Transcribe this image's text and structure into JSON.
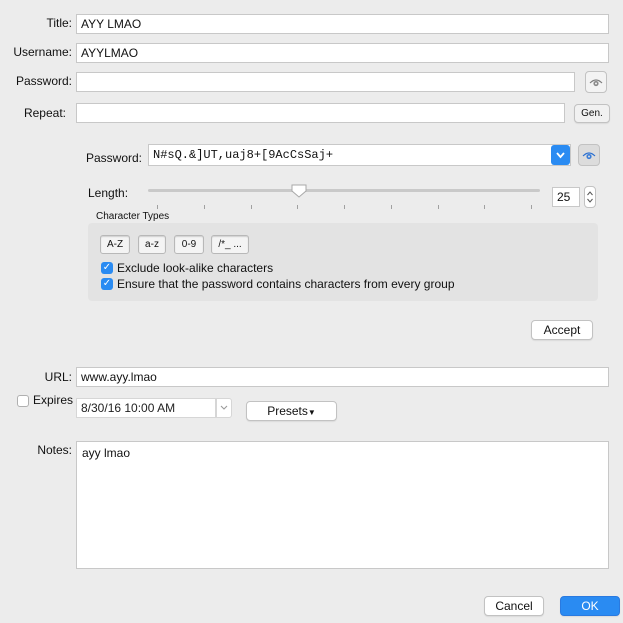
{
  "form": {
    "title_label": "Title:",
    "title_value": "AYY LMAO",
    "username_label": "Username:",
    "username_value": "AYYLMAO",
    "password_label": "Password:",
    "password_value": "",
    "repeat_label": "Repeat:",
    "repeat_value": "",
    "gen_button": "Gen.",
    "url_label": "URL:",
    "url_value": "www.ayy.lmao",
    "expires_label": "Expires",
    "expires_checked": false,
    "expires_value": "8/30/16 10:00 AM",
    "presets_button": "Presets",
    "notes_label": "Notes:",
    "notes_value": "ayy lmao"
  },
  "generator": {
    "password_label": "Password:",
    "password_value": "N#sQ.&]UT,uaj8+[9AcCsSaj+",
    "length_label": "Length:",
    "length_value": "25",
    "length_min": 1,
    "length_max": 64,
    "char_types_label": "Character Types",
    "char_types": [
      "A-Z",
      "a-z",
      "0-9",
      "/*_ ..."
    ],
    "exclude_lookalike_label": "Exclude look-alike characters",
    "exclude_lookalike_checked": true,
    "every_group_label": "Ensure that the password contains characters from every group",
    "every_group_checked": true,
    "accept_button": "Accept"
  },
  "dialog": {
    "cancel_button": "Cancel",
    "ok_button": "OK"
  },
  "colors": {
    "accent": "#2a8bf2",
    "background": "#ececec",
    "panel": "#e3e3e3"
  },
  "icons": {
    "reveal": "eye-icon",
    "dropdown": "chevron-down-icon",
    "stepper": "stepper-icon"
  }
}
